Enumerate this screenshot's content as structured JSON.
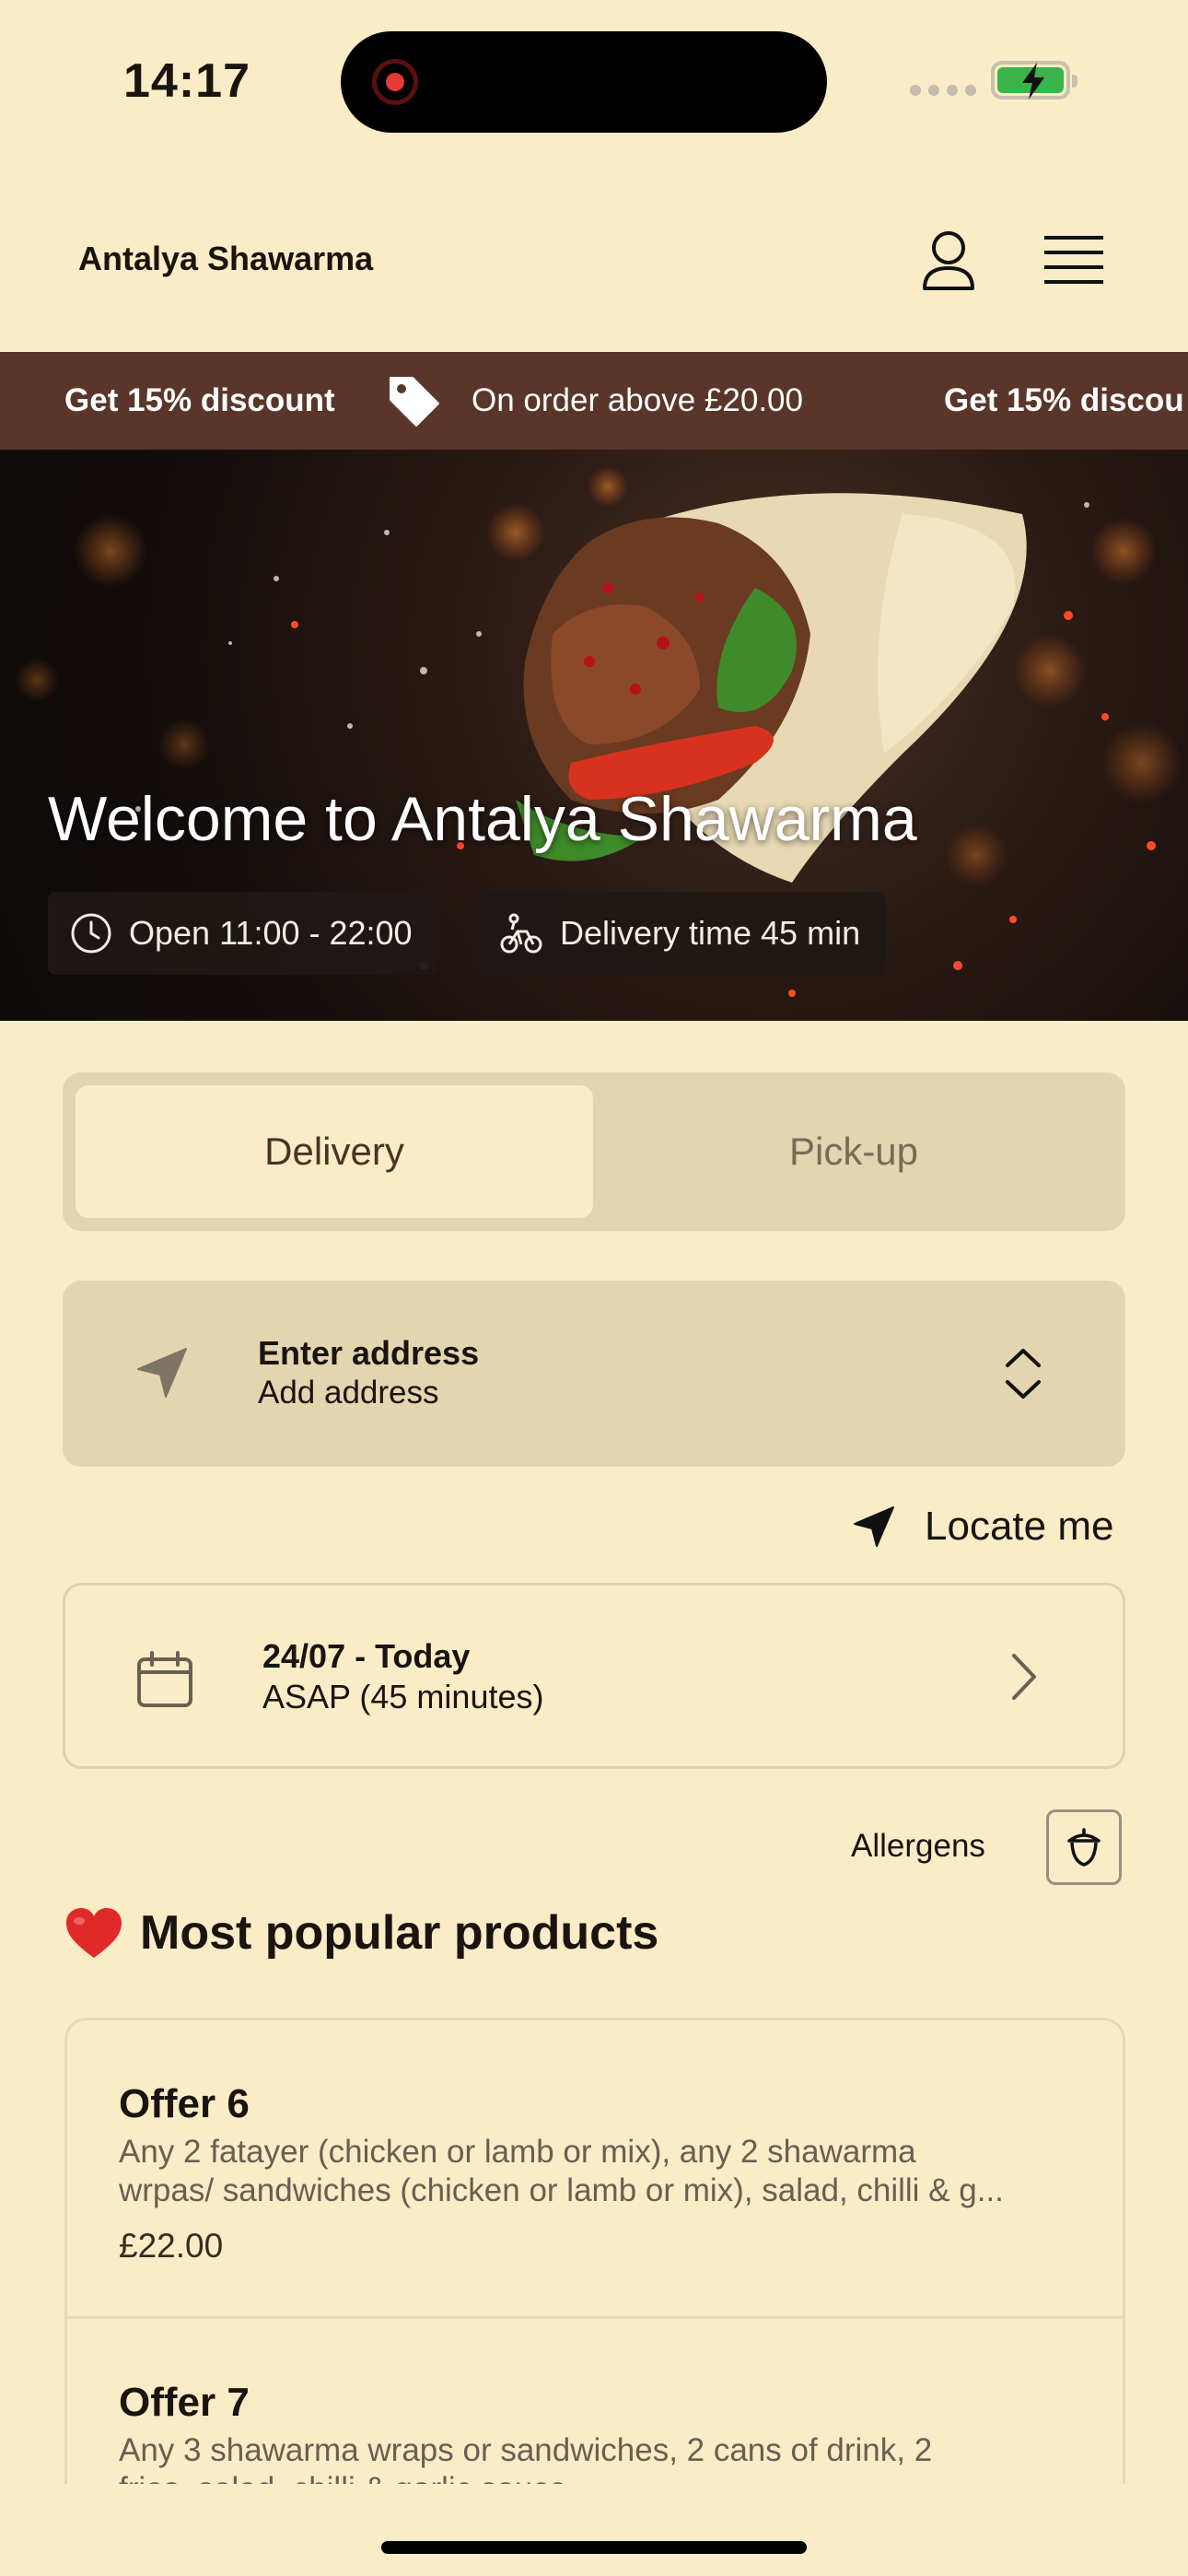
{
  "status_bar": {
    "time": "14:17"
  },
  "header": {
    "brand": "Antalya Shawarma"
  },
  "promo": [
    {
      "bold": "Get 15% discount",
      "text": "On order above £20.00"
    },
    {
      "bold": "Get 15% discou"
    }
  ],
  "hero": {
    "title": "Welcome to Antalya Shawarma",
    "hours": "Open 11:00 - 22:00",
    "delivery_time": "Delivery time 45 min"
  },
  "order_type": {
    "tabs": [
      "Delivery",
      "Pick-up"
    ],
    "selected": "Delivery"
  },
  "address": {
    "title": "Enter address",
    "subtitle": "Add address"
  },
  "locate": {
    "label": "Locate me"
  },
  "schedule": {
    "date": "24/07 - Today",
    "time": "ASAP (45 minutes)"
  },
  "allergens": {
    "label": "Allergens"
  },
  "popular": {
    "title": "Most popular products",
    "emoji": "❤️",
    "items": [
      {
        "name": "Offer 6",
        "desc_line1": "Any 2 fatayer (chicken or lamb or mix), any 2 shawarma",
        "desc_line2": "wrpas/ sandwiches (chicken or lamb or mix), salad, chilli & g...",
        "price": "£22.00"
      },
      {
        "name": "Offer 7",
        "desc_line1": "Any 3 shawarma wraps or sandwiches, 2 cans of drink, 2",
        "desc_line2": "fries, salad, chilli & garlic sauce"
      }
    ]
  },
  "colors": {
    "background": "#faecc6",
    "banner": "#5a362a",
    "segment": "#e3d5b0"
  },
  "icons": [
    "user-icon",
    "menu-icon",
    "tag-icon",
    "clock-icon",
    "bike-icon",
    "location-arrow-icon",
    "chevron-up-down-icon",
    "calendar-icon",
    "chevron-right-icon",
    "acorn-icon",
    "heart-emoji"
  ]
}
